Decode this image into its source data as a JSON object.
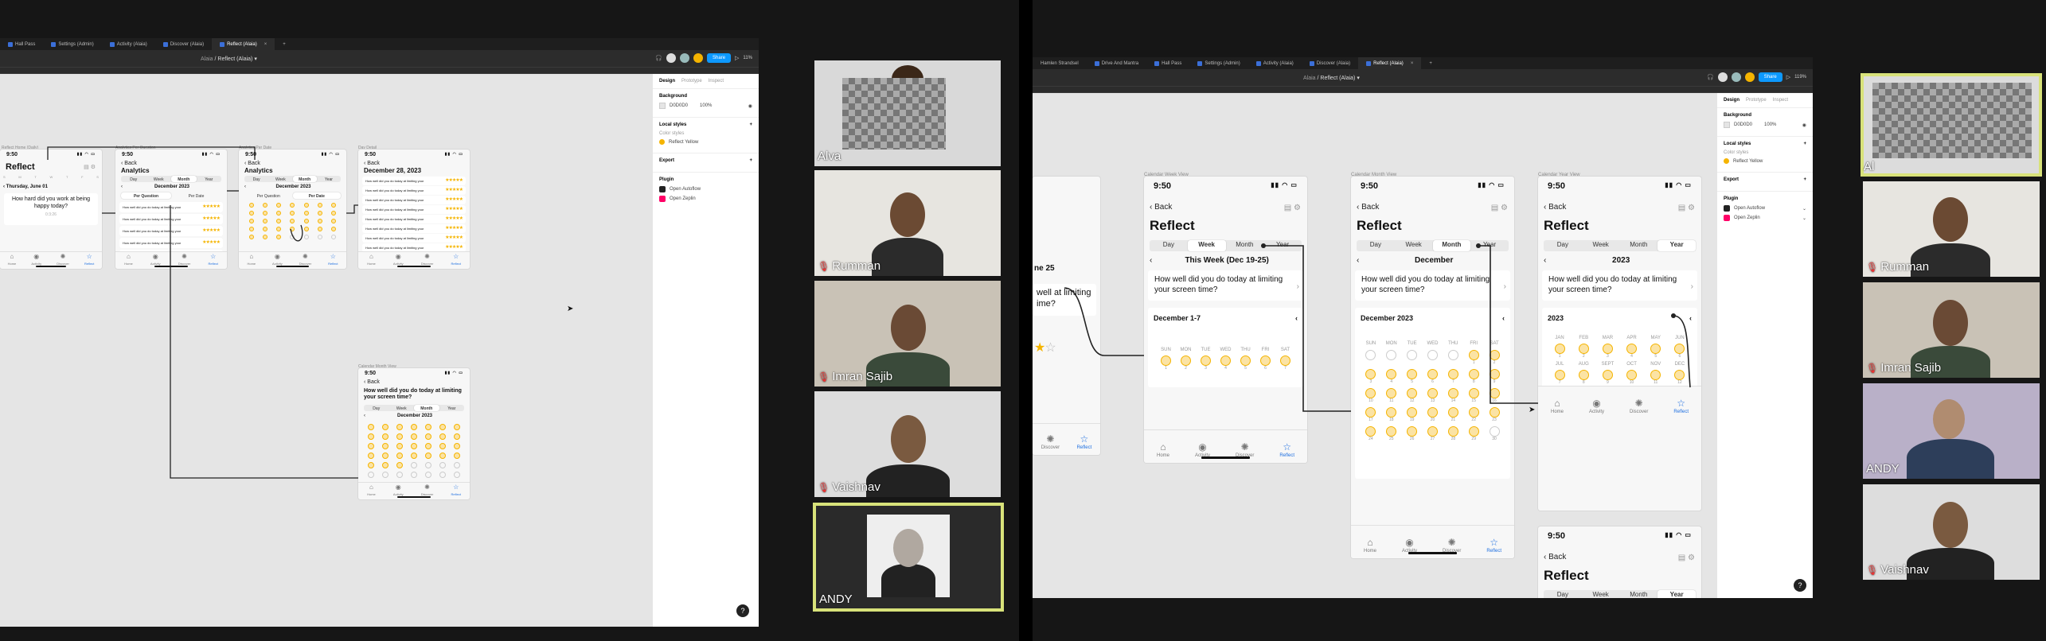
{
  "left": {
    "tabs": [
      "Hall Pass",
      "Settings (Admin)",
      "Activity (Alaia)",
      "Discover (Alaia)",
      "Reflect (Alaia)"
    ],
    "active_tab": "Reflect (Alaia)",
    "breadcrumb": {
      "project": "Alaia",
      "file": "Reflect (Alaia)"
    },
    "share_label": "Share",
    "zoom": "11%",
    "panel": {
      "tabs": [
        "Design",
        "Prototype",
        "Inspect"
      ],
      "background_label": "Background",
      "background_hex": "D0D0D0",
      "background_opacity": "100%",
      "local_styles": "Local styles",
      "color_styles": "Color styles",
      "style_name": "Reflect Yellow",
      "export": "Export",
      "plugin": "Plugin",
      "plugins": [
        "Open Autoflow",
        "Open Zeplin"
      ]
    },
    "frames": {
      "f1": {
        "time": "9:50",
        "title": "Reflect",
        "date": "Thursday, June 01",
        "question": "How hard did you work at being happy today?",
        "timer": "0:3:26"
      },
      "f2": {
        "time": "9:50",
        "back": "Back",
        "title": "Analytics",
        "month": "December 2023",
        "per_q": "Per Question",
        "per_date": "Per Date",
        "q": "How well did you do today at limiting your screen time?"
      },
      "f3": {
        "time": "9:50",
        "back": "Back",
        "title": "Analytics",
        "month": "December 2023",
        "per_q": "Per Question",
        "per_date": "Per Date"
      },
      "f4": {
        "time": "9:50",
        "back": "Back",
        "title": "December 28, 2023",
        "q": "How well did you do today at limiting your screen time?"
      },
      "f5": {
        "time": "9:50",
        "back": "Back",
        "q": "How well did you do today at limiting your screen time?",
        "month": "December 2023"
      }
    },
    "seg": [
      "Day",
      "Week",
      "Month",
      "Year"
    ],
    "nav": [
      "Home",
      "Activity",
      "Discover",
      "Reflect"
    ],
    "stars": "★★★★★"
  },
  "right": {
    "tabs": [
      "Hamlen Strandsel",
      "Drive And Mantra",
      "Hall Pass",
      "Settings (Admin)",
      "Activity (Alaia)",
      "Discover (Alaia)",
      "Reflect (Alaia)"
    ],
    "active_tab": "Reflect (Alaia)",
    "breadcrumb": {
      "project": "Alaia",
      "file": "Reflect (Alaia)"
    },
    "share_label": "Share",
    "zoom": "119%",
    "panel": {
      "tabs": [
        "Design",
        "Prototype",
        "Inspect"
      ],
      "background_label": "Background",
      "background_hex": "D0D0D0",
      "background_opacity": "100%",
      "local_styles": "Local styles",
      "color_styles": "Color styles",
      "style_name": "Reflect Yellow",
      "export": "Export",
      "plugin": "Plugin",
      "plugins": [
        "Open Autoflow",
        "Open Zeplin"
      ]
    },
    "partial": {
      "month": "ne 25",
      "q": "well at limiting ime?"
    },
    "week": {
      "time": "9:50",
      "back": "Back",
      "title": "Reflect",
      "range": "This Week (Dec 19-25)",
      "q": "How well did you do today at limiting your screen time?",
      "sub": "December 1-7",
      "days": [
        "SUN",
        "MON",
        "TUE",
        "WED",
        "THU",
        "FRI",
        "SAT"
      ],
      "nums": [
        "1",
        "2",
        "3",
        "4",
        "5",
        "6",
        "7"
      ]
    },
    "month": {
      "time": "9:50",
      "back": "Back",
      "title": "Reflect",
      "name": "December",
      "q": "How well did you do today at limiting your screen time?",
      "sub": "December 2023",
      "days": [
        "SUN",
        "MON",
        "TUE",
        "WED",
        "THU",
        "FRI",
        "SAT"
      ]
    },
    "year": {
      "time": "9:50",
      "back": "Back",
      "title": "Reflect",
      "name": "2023",
      "q": "How well did you do today at limiting your screen time?",
      "sub": "2023",
      "months": [
        "JAN",
        "FEB",
        "MAR",
        "APR",
        "MAY",
        "JUN",
        "JUL",
        "AUG",
        "SEPT",
        "OCT",
        "NOV",
        "DEC"
      ]
    },
    "year2": {
      "time": "9:50",
      "back": "Back",
      "title": "Reflect"
    },
    "seg": [
      "Day",
      "Week",
      "Month",
      "Year"
    ],
    "nav": [
      "Home",
      "Activity",
      "Discover",
      "Reflect"
    ]
  },
  "participants_left": [
    {
      "name": "Alva"
    },
    {
      "name": "Rumman"
    },
    {
      "name": "Imran Sajib"
    },
    {
      "name": "Vaishnav"
    },
    {
      "name": "ANDY"
    }
  ],
  "participants_right": [
    {
      "name": "Al"
    },
    {
      "name": "Rumman"
    },
    {
      "name": "Imran Sajib"
    },
    {
      "name": "ANDY"
    },
    {
      "name": "Vaishnav"
    }
  ]
}
